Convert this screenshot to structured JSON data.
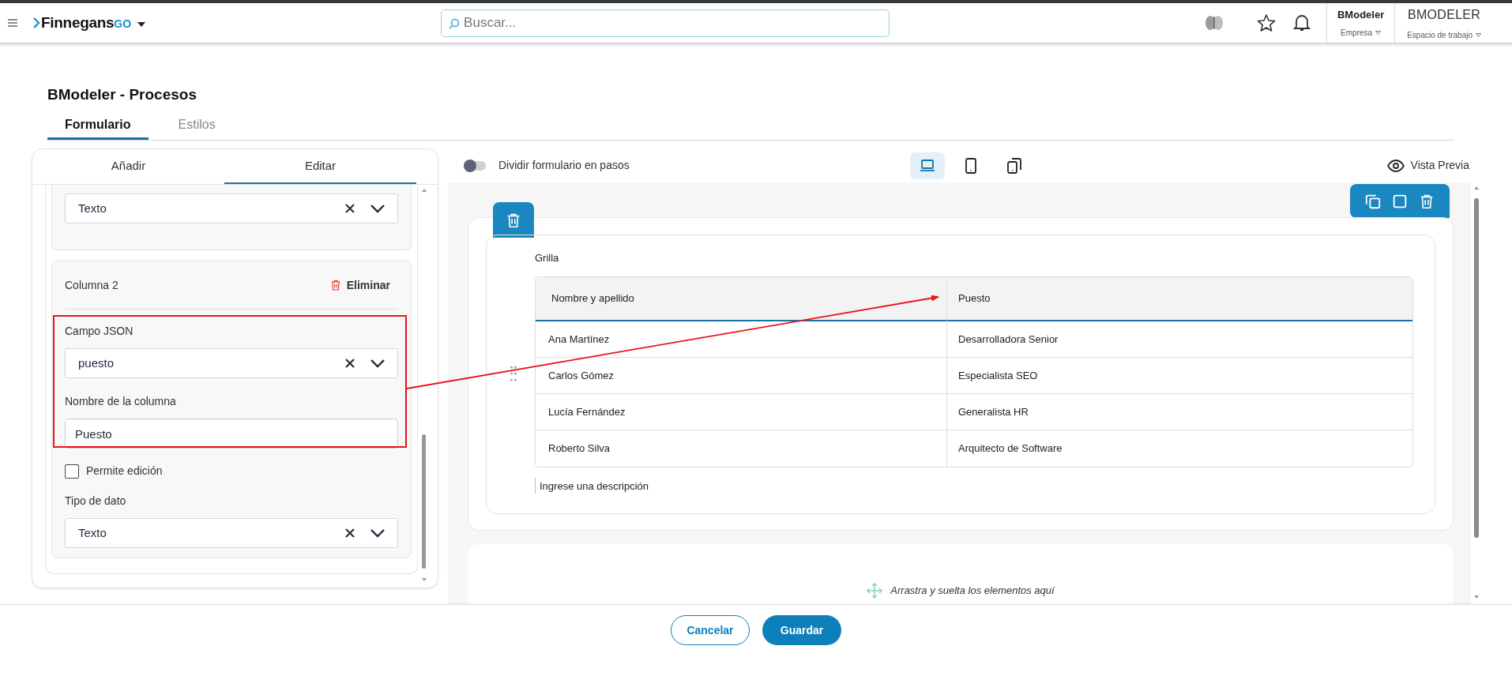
{
  "header": {
    "brand": "Finnegans",
    "brand_suffix": "GO",
    "search": {
      "placeholder": "Buscar..."
    },
    "company": {
      "name": "BModeler",
      "label": "Empresa"
    },
    "workspace": {
      "name": "BMODELER",
      "label": "Espacio de trabajo"
    }
  },
  "page_title": "BModeler - Procesos",
  "tabs": [
    {
      "label": "Formulario",
      "selected": true
    },
    {
      "label": "Estilos",
      "selected": false
    }
  ],
  "editor": {
    "tabs": [
      {
        "label": "Añadir",
        "selected": false
      },
      {
        "label": "Editar",
        "selected": true
      }
    ],
    "previous_select": {
      "value": "Texto"
    },
    "column": {
      "title": "Columna 2",
      "delete": "Eliminar",
      "json_field": {
        "label": "Campo JSON",
        "value": "puesto"
      },
      "name_field": {
        "label": "Nombre de la columna",
        "value": "Puesto"
      },
      "editable": {
        "label": "Permite edición",
        "checked": false
      },
      "type_field": {
        "label": "Tipo de dato",
        "value": "Texto"
      }
    }
  },
  "toolbar": {
    "split_steps": {
      "label": "Dividir formulario en pasos",
      "on": false
    },
    "devices": [
      {
        "kind": "laptop",
        "selected": true
      },
      {
        "kind": "tablet",
        "selected": false
      },
      {
        "kind": "rotate",
        "selected": false
      }
    ],
    "preview": "Vista Previa"
  },
  "grid": {
    "label": "Grilla",
    "columns": [
      "Nombre y apellido",
      "Puesto"
    ],
    "rows": [
      [
        "Ana Martínez",
        "Desarrolladora Senior"
      ],
      [
        "Carlos Gómez",
        "Especialista SEO"
      ],
      [
        "Lucía Fernández",
        "Generalista HR"
      ],
      [
        "Roberto Silva",
        "Arquitecto de Software"
      ]
    ],
    "description": {
      "placeholder": "Ingrese una descripción"
    }
  },
  "dropzone": "Arrastra y suelta los elementos aquí",
  "buttons": [
    {
      "label": "Cancelar",
      "kind": "secondary"
    },
    {
      "label": "Guardar",
      "kind": "primary"
    }
  ]
}
